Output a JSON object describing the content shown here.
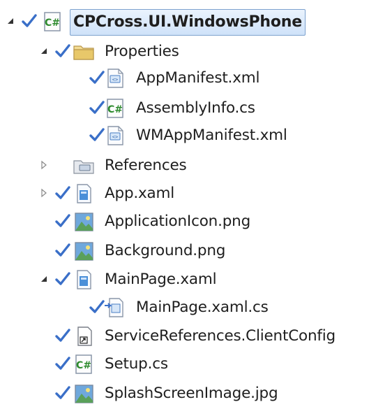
{
  "solution_explorer": {
    "items": [
      {
        "label": "CPCross.UI.WindowsPhone",
        "icon": "csharp-project-icon",
        "expander": "expanded",
        "checked": true
      },
      {
        "label": "Properties",
        "icon": "folder-icon",
        "expander": "expanded",
        "checked": true
      },
      {
        "label": "AppManifest.xml",
        "icon": "xml-file-icon",
        "expander": "none",
        "checked": true
      },
      {
        "label": "AssemblyInfo.cs",
        "icon": "csharp-file-icon",
        "expander": "none",
        "checked": true
      },
      {
        "label": "WMAppManifest.xml",
        "icon": "xml-file-icon",
        "expander": "none",
        "checked": true
      },
      {
        "label": "References",
        "icon": "references-icon",
        "expander": "collapsed",
        "checked": false
      },
      {
        "label": "App.xaml",
        "icon": "xaml-file-icon",
        "expander": "collapsed",
        "checked": true
      },
      {
        "label": "ApplicationIcon.png",
        "icon": "image-file-icon",
        "expander": "none",
        "checked": true
      },
      {
        "label": "Background.png",
        "icon": "image-file-icon",
        "expander": "none",
        "checked": true
      },
      {
        "label": "MainPage.xaml",
        "icon": "xaml-file-icon",
        "expander": "expanded",
        "checked": true
      },
      {
        "label": "MainPage.xaml.cs",
        "icon": "code-behind-file-icon",
        "expander": "none",
        "checked": true
      },
      {
        "label": "ServiceReferences.ClientConfig",
        "icon": "config-file-icon",
        "expander": "none",
        "checked": true
      },
      {
        "label": "Setup.cs",
        "icon": "csharp-file-icon",
        "expander": "none",
        "checked": true
      },
      {
        "label": "SplashScreenImage.jpg",
        "icon": "image-file-icon",
        "expander": "none",
        "checked": true
      }
    ]
  },
  "colors": {
    "check": "#3a6fc8",
    "selection_border": "#7da2ce",
    "csharp_icon": "#2e8b2e",
    "folder": "#e8c86a",
    "xaml_icon": "#4a8fd8",
    "image_sky": "#6fa8dc",
    "image_hill": "#5aa05a"
  }
}
